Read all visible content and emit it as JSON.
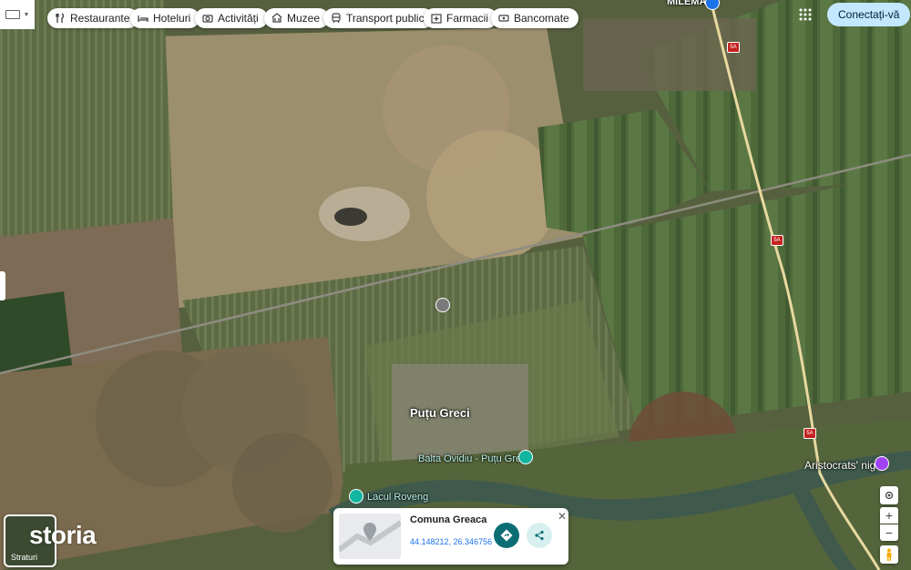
{
  "toolbar": {
    "chips": [
      {
        "label": "Restaurante",
        "icon": "fork-knife-icon"
      },
      {
        "label": "Hoteluri",
        "icon": "bed-icon"
      },
      {
        "label": "Activități",
        "icon": "camera-icon"
      },
      {
        "label": "Muzee",
        "icon": "museum-icon"
      },
      {
        "label": "Transport public",
        "icon": "train-icon"
      },
      {
        "label": "Farmacii",
        "icon": "pharmacy-icon"
      },
      {
        "label": "Bancomate",
        "icon": "atm-icon"
      }
    ],
    "sign_in": "Conectați-vă"
  },
  "map": {
    "labels": {
      "town": "Puțu Greci",
      "town_north": "MILEMA",
      "lake_balta": "Balta Ovidiu - Puțu Greci",
      "lake_roveng": "Lacul Roveng",
      "poi": "Aristocrats' night"
    },
    "road_shields": [
      "5A",
      "5A",
      "5A"
    ],
    "watermark": "storia",
    "layers_label": "Straturi"
  },
  "place_card": {
    "title": "Comuna Greaca",
    "coords": "44.148212, 26.346756"
  }
}
